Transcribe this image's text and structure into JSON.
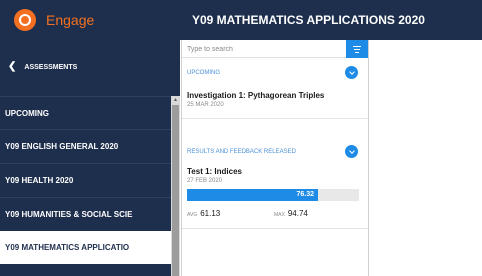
{
  "brand": {
    "name": "Engage",
    "color": "#f37021"
  },
  "sidebar": {
    "back_label": "ASSESSMENTS",
    "items": [
      {
        "label": "UPCOMING"
      },
      {
        "label": "Y09 ENGLISH GENERAL 2020"
      },
      {
        "label": "Y09 HEALTH 2020"
      },
      {
        "label": "Y09 HUMANITIES & SOCIAL SCIE"
      },
      {
        "label": "Y09 MATHEMATICS APPLICATIO",
        "active": true
      }
    ]
  },
  "header": {
    "title": "Y09 MATHEMATICS APPLICATIONS 2020"
  },
  "search": {
    "placeholder": "Type to search"
  },
  "sections": {
    "upcoming": {
      "label": "UPCOMING",
      "items": [
        {
          "title": "Investigation 1: Pythagorean Triples",
          "date": "25 MAR 2020"
        }
      ]
    },
    "results": {
      "label": "RESULTS AND FEEDBACK RELEASED",
      "items": [
        {
          "title": "Test 1: Indices",
          "date": "27 FEB 2020",
          "score": "76.32",
          "score_fraction": 0.7632,
          "avg_label": "AVG",
          "avg": "61.13",
          "max_label": "MAX",
          "max": "94.74"
        }
      ]
    }
  },
  "colors": {
    "navy": "#1e2f4d",
    "accent_blue": "#1e8be6",
    "orange": "#f37021"
  },
  "icons": [
    "engage-logo-icon",
    "chevron-left-icon",
    "filter-icon",
    "chevron-down-icon"
  ]
}
